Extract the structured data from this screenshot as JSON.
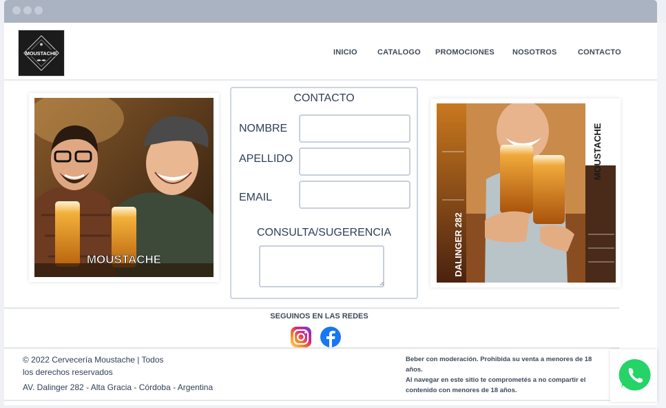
{
  "browser": {
    "dots": [
      "dot",
      "dot",
      "dot"
    ]
  },
  "header": {
    "logo_text": "MOUSTACHE",
    "nav": [
      "INICIO",
      "CATALOGO",
      "PROMOCIONES",
      "NOSOTROS",
      "CONTACTO"
    ]
  },
  "left_photo": {
    "caption": "MOUSTACHE"
  },
  "right_photo": {
    "vertical_brand": "MOUSTACHE",
    "vertical_address": "DALINGER 282"
  },
  "form": {
    "title": "CONTACTO",
    "fields": [
      {
        "label": "NOMBRE",
        "value": ""
      },
      {
        "label": "APELLIDO",
        "value": ""
      },
      {
        "label": "EMAIL",
        "value": ""
      }
    ],
    "message_label": "CONSULTA/SUGERENCIA",
    "message_value": ""
  },
  "social": {
    "title": "SEGUINOS EN LAS REDES",
    "icons": [
      "instagram-icon",
      "facebook-icon"
    ]
  },
  "footer": {
    "copyright_line1": "© 2022 Cervecería Moustache | Todos",
    "copyright_line2": "los derechos reservados",
    "address": "AV. Dalinger 282 - Alta Gracia - Córdoba - Argentina",
    "legal_line1": "Beber con moderación. Prohibida su venta a menores de 18 años.",
    "legal_line2": "Al navegar en este sitio te comprometés a no compartir el contenido con menores de 18 años."
  },
  "colors": {
    "accent_text": "#2e3f56",
    "border": "#c7cfdb",
    "whatsapp": "#25d366"
  },
  "floating": {
    "icon": "whatsapp-icon"
  }
}
